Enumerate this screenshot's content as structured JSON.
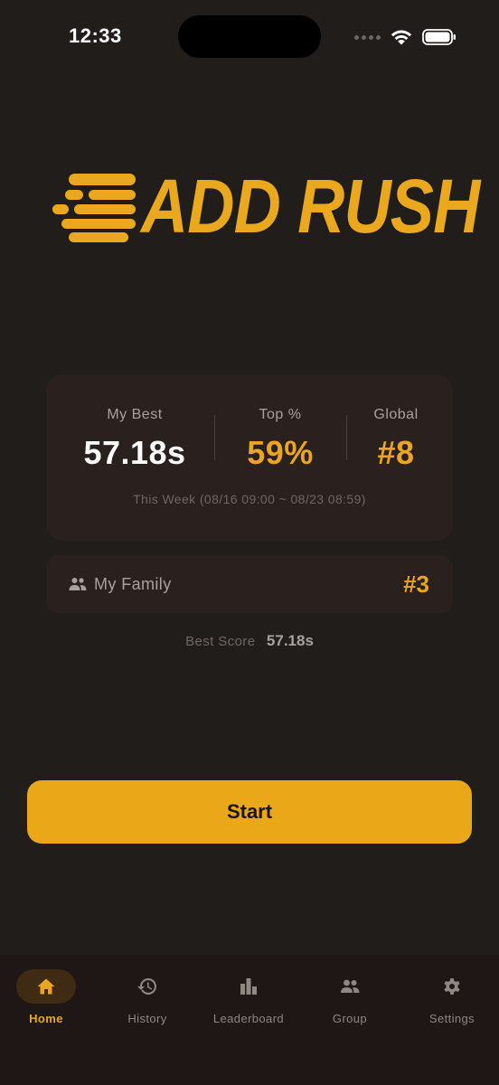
{
  "status_bar": {
    "time": "12:33"
  },
  "app": {
    "logo_text": "ADD RUSH",
    "accent_color": "#eaa622"
  },
  "stats": {
    "best": {
      "label": "My Best",
      "value": "57.18s"
    },
    "top_percent": {
      "label": "Top %",
      "value": "59%"
    },
    "global": {
      "label": "Global",
      "value": "#8"
    },
    "week_range": "This Week (08/16 09:00 ~ 08/23 08:59)"
  },
  "family": {
    "icon": "group-icon",
    "label": "My Family",
    "rank": "#3"
  },
  "best_score": {
    "label": "Best Score",
    "value": "57.18s"
  },
  "start_button": {
    "label": "Start"
  },
  "tabs": [
    {
      "label": "Home",
      "icon": "home-icon",
      "active": true
    },
    {
      "label": "History",
      "icon": "history-icon",
      "active": false
    },
    {
      "label": "Leaderboard",
      "icon": "leaderboard-icon",
      "active": false
    },
    {
      "label": "Group",
      "icon": "group-icon",
      "active": false
    },
    {
      "label": "Settings",
      "icon": "gear-icon",
      "active": false
    }
  ]
}
